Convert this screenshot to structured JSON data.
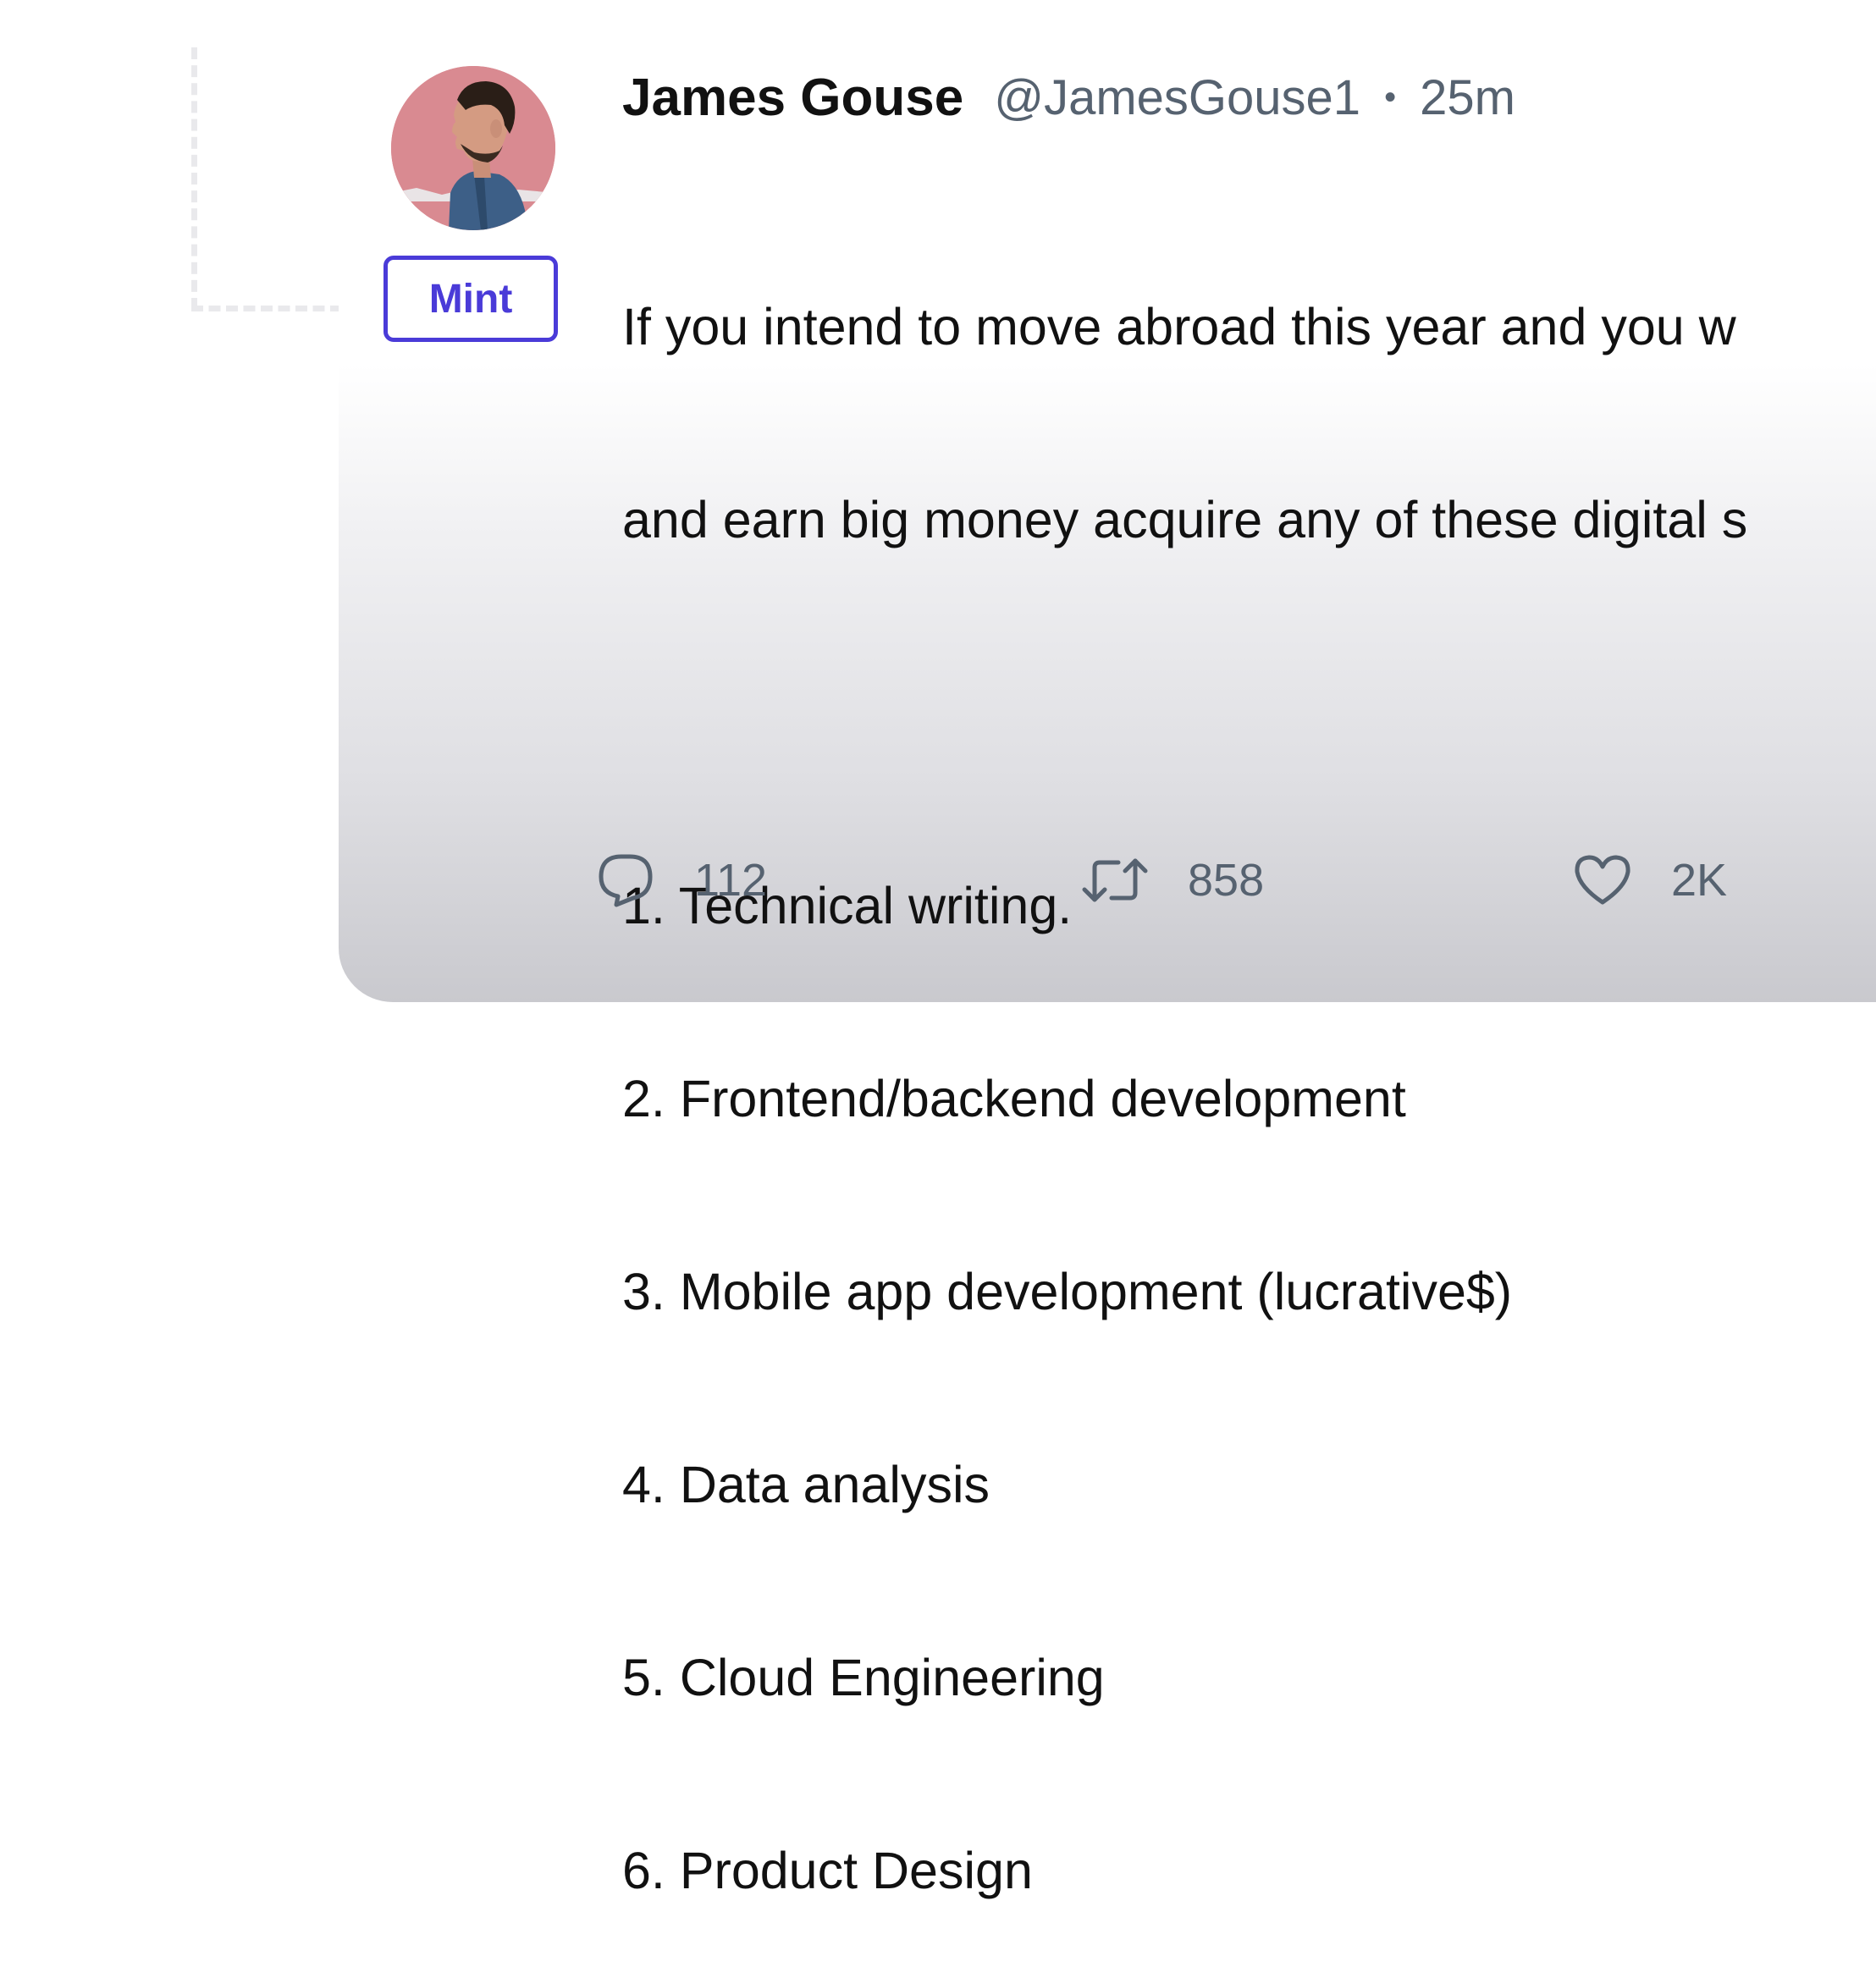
{
  "mint_button": {
    "label": "Mint"
  },
  "tweet": {
    "author_name": "James Gouse",
    "author_handle": "@JamesGouse1",
    "separator": "•",
    "time_ago": "25m",
    "body_lines": [
      "If you intend to move abroad this year and you w",
      "and earn big money acquire any of these digital s"
    ],
    "list_items": [
      "1. Technical writing.",
      "2. Frontend/backend development",
      "3. Mobile app development (lucrative$)",
      "4. Data analysis",
      "5. Cloud Engineering",
      "6. Product Design"
    ],
    "actions": {
      "reply_count": "112",
      "retweet_count": "858",
      "like_count": "2K"
    }
  },
  "icons": {
    "reply": "speech-bubble-icon",
    "retweet": "retweet-arrows-icon",
    "like": "heart-icon"
  },
  "colors": {
    "mint_accent": "#4a3bd8",
    "text_primary": "#111111",
    "text_secondary": "#566270",
    "avatar_background": "#d98a91"
  }
}
